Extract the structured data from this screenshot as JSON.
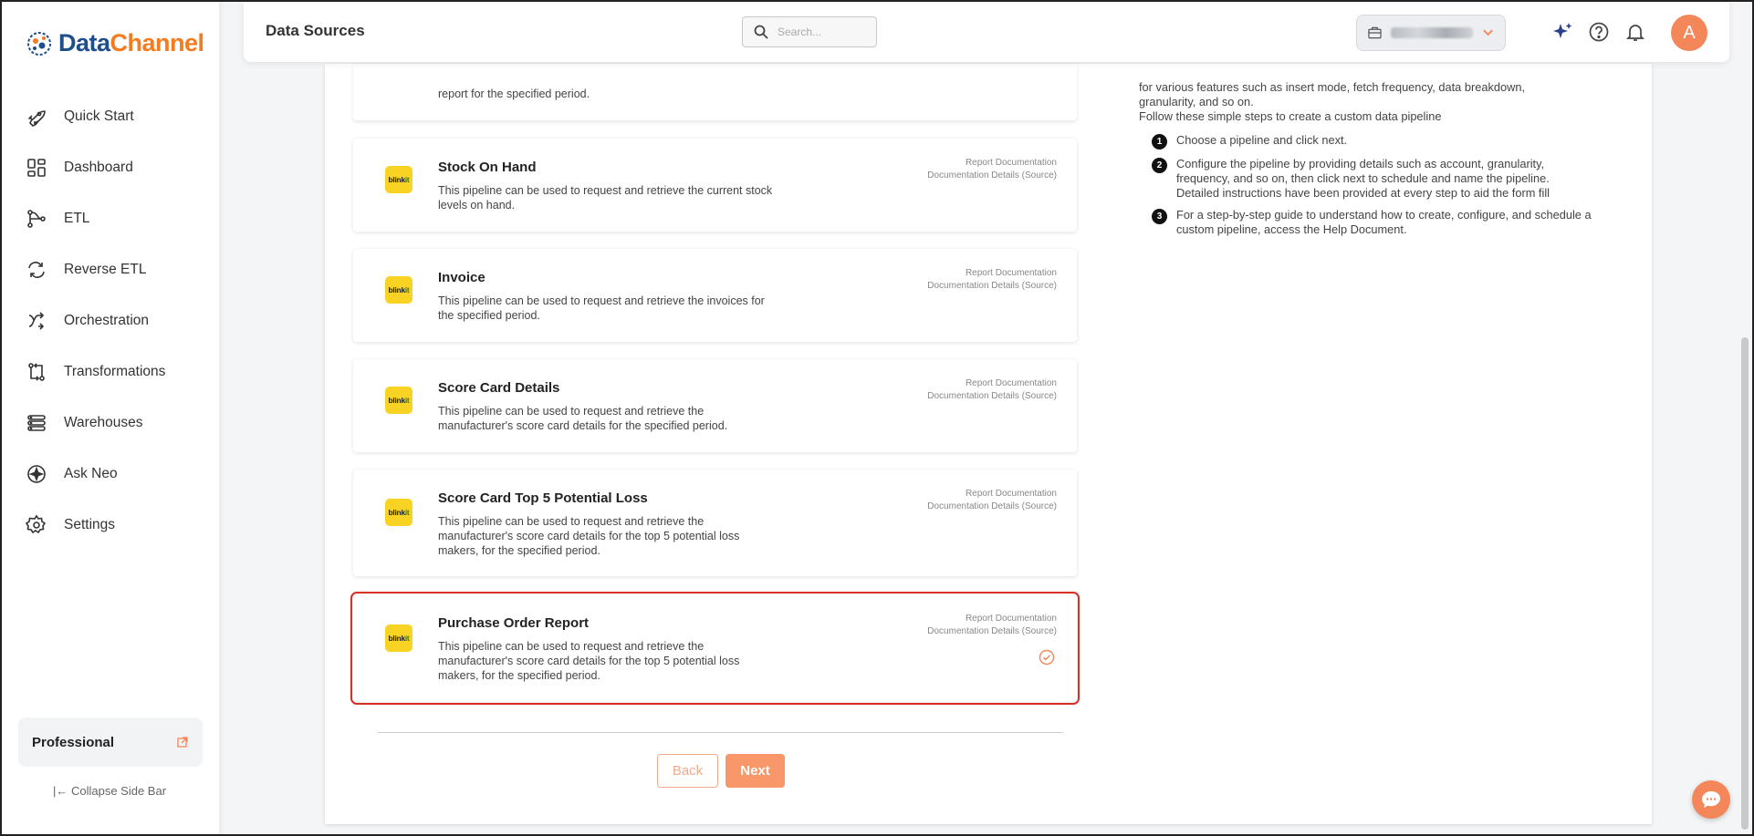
{
  "app": {
    "brand_part1": "Data",
    "brand_part2": "Channel",
    "colors": {
      "accent": "#f4875a",
      "brand_blue": "#1f4e8c",
      "brand_orange": "#f47b20",
      "selection": "#d93025"
    }
  },
  "sidebar": {
    "items": [
      {
        "label": "Quick Start",
        "icon": "rocket-icon"
      },
      {
        "label": "Dashboard",
        "icon": "dashboard-icon"
      },
      {
        "label": "ETL",
        "icon": "etl-icon"
      },
      {
        "label": "Reverse ETL",
        "icon": "reverse-etl-icon"
      },
      {
        "label": "Orchestration",
        "icon": "orchestration-icon"
      },
      {
        "label": "Transformations",
        "icon": "transformations-icon"
      },
      {
        "label": "Warehouses",
        "icon": "warehouses-icon"
      },
      {
        "label": "Ask Neo",
        "icon": "sparkle-icon"
      },
      {
        "label": "Settings",
        "icon": "gear-icon"
      }
    ],
    "plan_label": "Professional",
    "collapse_label": "Collapse Side Bar"
  },
  "header": {
    "title": "Data Sources",
    "search_placeholder": "Search...",
    "avatar_letter": "A"
  },
  "top_snippet": "report for the specified period.",
  "cards": [
    {
      "title": "Stock On Hand",
      "desc": "This pipeline can be used to request and retrieve the current stock levels on hand.",
      "doc1": "Report Documentation",
      "doc2": "Documentation Details (Source)",
      "logo_a": "blink",
      "logo_b": "it"
    },
    {
      "title": "Invoice",
      "desc": "This pipeline can be used to request and retrieve the invoices for the specified period.",
      "doc1": "Report Documentation",
      "doc2": "Documentation Details (Source)",
      "logo_a": "blink",
      "logo_b": "it"
    },
    {
      "title": "Score Card Details",
      "desc": "This pipeline can be used to request and retrieve the manufacturer's score card details for the specified period.",
      "doc1": "Report Documentation",
      "doc2": "Documentation Details (Source)",
      "logo_a": "blink",
      "logo_b": "it"
    },
    {
      "title": "Score Card Top 5 Potential Loss",
      "desc": "This pipeline can be used to request and retrieve the manufacturer's score card details for the top 5 potential loss makers, for the specified period.",
      "doc1": "Report Documentation",
      "doc2": "Documentation Details (Source)",
      "logo_a": "blink",
      "logo_b": "it"
    },
    {
      "title": "Purchase Order Report",
      "desc": "This pipeline can be used to request and retrieve the manufacturer's score card details for the top 5 potential loss makers, for the specified period.",
      "doc1": "Report Documentation",
      "doc2": "Documentation Details (Source)",
      "logo_a": "blink",
      "logo_b": "it",
      "selected": true
    }
  ],
  "buttons": {
    "back": "Back",
    "next": "Next"
  },
  "help": {
    "intro_line1": "for various features such as insert mode, fetch frequency, data breakdown,",
    "intro_line2": "granularity, and so on.",
    "intro_line3": "Follow these simple steps to create a custom data pipeline",
    "steps": [
      {
        "num": "1",
        "text": "Choose a pipeline and click next."
      },
      {
        "num": "2",
        "text": "Configure the pipeline by providing details such as account, granularity, frequency, and so on, then click next to schedule and name the pipeline. Detailed instructions have been provided at every step to aid the form fill"
      },
      {
        "num": "3",
        "text": "For a step-by-step guide to understand how to create, configure, and schedule a custom pipeline, access the Help Document."
      }
    ]
  }
}
